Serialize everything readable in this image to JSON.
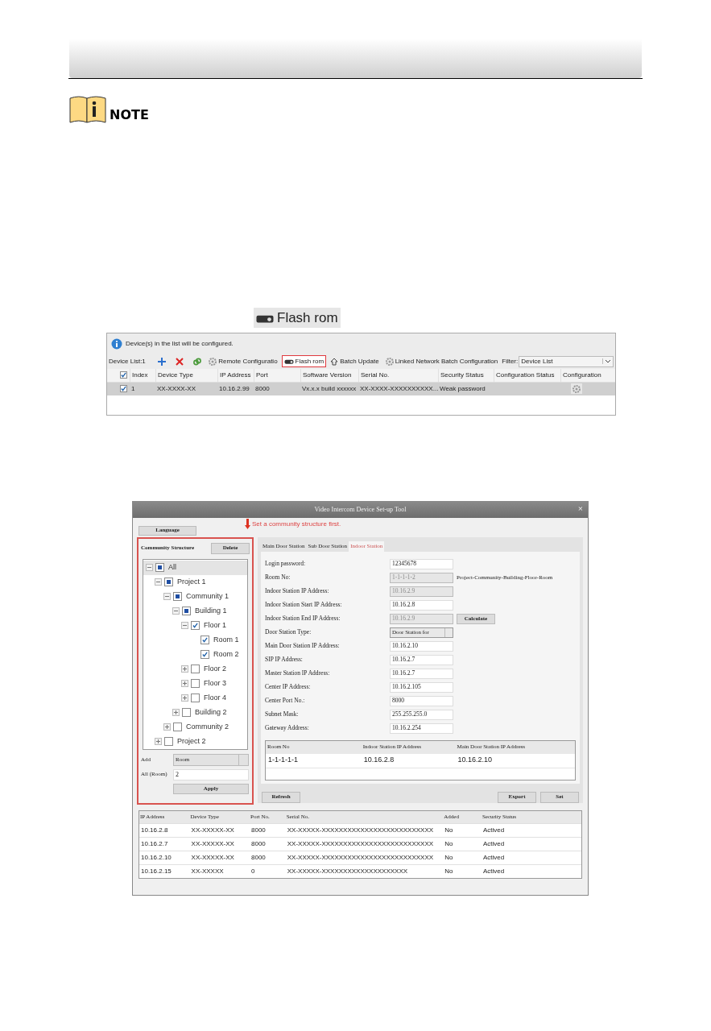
{
  "note": {
    "label": "NOTE"
  },
  "flash_rom_button": {
    "label": "Flash rom"
  },
  "device_window": {
    "info": "Device(s) in the list will be configured.",
    "device_list_label": "Device List:1",
    "toolbar": [
      {
        "kind": "add"
      },
      {
        "kind": "delete"
      },
      {
        "kind": "link"
      },
      {
        "kind": "gear",
        "label": "Remote Configuratio",
        "highlighted": false
      },
      {
        "kind": "rom",
        "label": "Flash rom",
        "highlighted": true
      },
      {
        "kind": "upload",
        "label": "Batch Update",
        "highlighted": false
      },
      {
        "kind": "gear",
        "label": "Linked Network Batch Configuration",
        "highlighted": false
      }
    ],
    "filter": {
      "label": "Filter:",
      "value": "Device List"
    },
    "header_checked": true,
    "columns": [
      "Index",
      "Device Type",
      "IP Address",
      "Port",
      "Software Version",
      "Serial No.",
      "Security Status",
      "Configuration Status",
      "Configuration"
    ],
    "rows": [
      {
        "checked": true,
        "selected": true,
        "cells": [
          "1",
          "XX-XXXX-XX",
          "10.16.2.99",
          "8000",
          "Vx.x.x build xxxxxx",
          "XX-XXXX-XXXXXXXXXX...",
          "Weak password",
          ""
        ]
      }
    ]
  },
  "setup_tool": {
    "title": "Video Intercom Device Set-up Tool",
    "close": "×",
    "language_button": "Language",
    "annotation": "Set a community structure first.",
    "structure": {
      "heading": "Community Structure",
      "delete_button": "Delete",
      "tree": [
        {
          "label": "All",
          "checked": false,
          "partial": true,
          "expanded": true,
          "selected": true,
          "children": [
            {
              "label": "Project 1",
              "checked": false,
              "partial": true,
              "expanded": true,
              "selected": false,
              "children": [
                {
                  "label": "Community 1",
                  "checked": false,
                  "partial": true,
                  "expanded": true,
                  "selected": false,
                  "children": [
                    {
                      "label": "Building 1",
                      "checked": false,
                      "partial": true,
                      "expanded": true,
                      "selected": false,
                      "children": [
                        {
                          "label": "Floor 1",
                          "checked": true,
                          "partial": false,
                          "expanded": true,
                          "selected": false,
                          "children": [
                            {
                              "label": "Room 1",
                              "checked": true,
                              "partial": false,
                              "selected": false
                            },
                            {
                              "label": "Room 2",
                              "checked": true,
                              "partial": false,
                              "selected": false
                            }
                          ]
                        },
                        {
                          "label": "Floor 2",
                          "checked": false,
                          "partial": false,
                          "expanded": false,
                          "selected": false
                        },
                        {
                          "label": "Floor 3",
                          "checked": false,
                          "partial": false,
                          "expanded": false,
                          "selected": false
                        },
                        {
                          "label": "Floor 4",
                          "checked": false,
                          "partial": false,
                          "expanded": false,
                          "selected": false
                        }
                      ]
                    },
                    {
                      "label": "Building 2",
                      "checked": false,
                      "partial": false,
                      "expanded": false,
                      "selected": false
                    }
                  ]
                },
                {
                  "label": "Community 2",
                  "checked": false,
                  "partial": false,
                  "expanded": false,
                  "selected": false
                }
              ]
            },
            {
              "label": "Project 2",
              "checked": false,
              "partial": false,
              "expanded": false,
              "selected": false
            }
          ]
        }
      ],
      "add_label": "Add",
      "add_value": "Room",
      "all_label": "All (Room)",
      "all_value": "2",
      "apply_button": "Apply"
    },
    "tabs": [
      {
        "label": "Main Door Station",
        "selected": false
      },
      {
        "label": "Sub Door Station",
        "selected": false
      },
      {
        "label": "Indoor Station",
        "selected": true
      }
    ],
    "fields": [
      {
        "kind": "text",
        "label": "Login password:",
        "value": "12345678",
        "disabled": false
      },
      {
        "kind": "text",
        "label": "Room No:",
        "value": "1-1-1-1-2",
        "disabled": true,
        "hint": "Project-Community-Building-Floor-Room"
      },
      {
        "kind": "text",
        "label": "Indoor Station IP Address:",
        "value": "10.16.2.9",
        "disabled": true
      },
      {
        "kind": "text",
        "label": "Indoor Station Start IP Address:",
        "value": "10.16.2.8",
        "disabled": false
      },
      {
        "kind": "text",
        "label": "Indoor Station End IP Address:",
        "value": "10.16.2.9",
        "disabled": true,
        "button": "Calculate"
      },
      {
        "kind": "select",
        "label": "Door Station Type:",
        "value": "Door Station for"
      },
      {
        "kind": "text",
        "label": "Main Door Station IP Address:",
        "value": "10.16.2.10",
        "disabled": false
      },
      {
        "kind": "text",
        "label": "SIP IP Address:",
        "value": "10.16.2.7",
        "disabled": false
      },
      {
        "kind": "text",
        "label": "Master Station IP Address:",
        "value": "10.16.2.7",
        "disabled": false
      },
      {
        "kind": "text",
        "label": "Center IP Address:",
        "value": "10.16.2.105",
        "disabled": false
      },
      {
        "kind": "text",
        "label": "Center Port No.:",
        "value": "8000",
        "disabled": false
      },
      {
        "kind": "text",
        "label": "Subnet Mask:",
        "value": "255.255.255.0",
        "disabled": false
      },
      {
        "kind": "text",
        "label": "Gateway Address:",
        "value": "10.16.2.254",
        "disabled": false
      }
    ],
    "room_table": {
      "columns": [
        "Room No",
        "Indoor Station IP Address",
        "Main Door Station IP Address"
      ],
      "rows": [
        [
          "1-1-1-1-1",
          "10.16.2.8",
          "10.16.2.10"
        ]
      ]
    },
    "buttons": {
      "refresh": "Refresh",
      "export": "Export",
      "set": "Set"
    },
    "device_table": {
      "columns": [
        "IP Address",
        "Device Type",
        "Port No.",
        "Serial No.",
        "Added",
        "Security Status"
      ],
      "rows": [
        [
          "10.16.2.8",
          "XX-XXXXX-XX",
          "8000",
          "XX-XXXXX-XXXXXXXXXXXXXXXXXXXXXXXXXX",
          "No",
          "Actived"
        ],
        [
          "10.16.2.7",
          "XX-XXXXX-XX",
          "8000",
          "XX-XXXXX-XXXXXXXXXXXXXXXXXXXXXXXXXX",
          "No",
          "Actived"
        ],
        [
          "10.16.2.10",
          "XX-XXXXX-XX",
          "8000",
          "XX-XXXXX-XXXXXXXXXXXXXXXXXXXXXXXXXX",
          "No",
          "Actived"
        ],
        [
          "10.16.2.15",
          "XX-XXXXX",
          "0",
          "XX-XXXXX-XXXXXXXXXXXXXXXXXXXX",
          "No",
          "Actived"
        ]
      ]
    }
  }
}
